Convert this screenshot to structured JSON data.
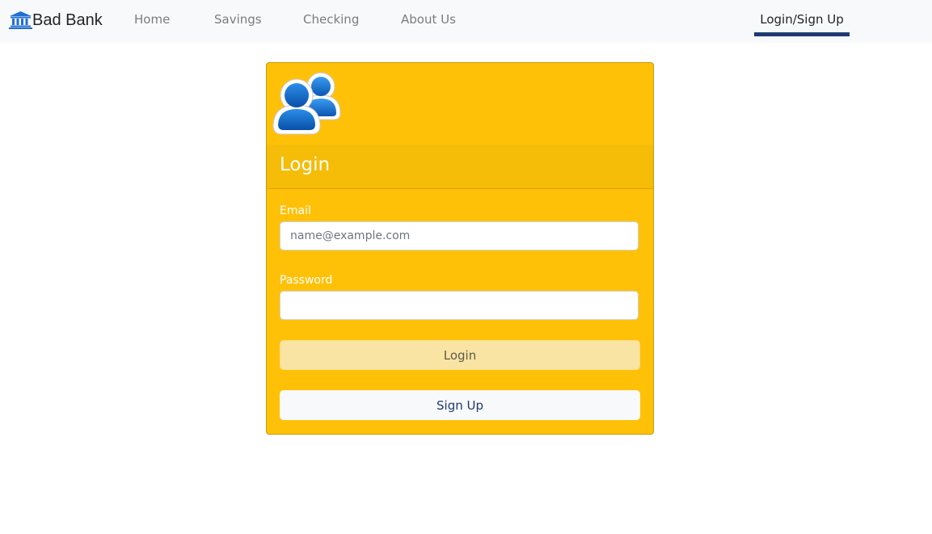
{
  "navbar": {
    "brand": {
      "icon": "bank-building-icon",
      "text": "Bad Bank",
      "icon_color": "#1f6fd1"
    },
    "links": [
      {
        "label": "Home"
      },
      {
        "label": "Savings"
      },
      {
        "label": "Checking"
      },
      {
        "label": "About Us"
      }
    ],
    "active_link": {
      "label": "Login/Sign Up"
    },
    "active_indicator_color": "#1f3a73"
  },
  "card": {
    "icon": "users-icon",
    "background_color": "#ffc107",
    "title": "Login",
    "email": {
      "label": "Email",
      "placeholder": "name@example.com",
      "value": ""
    },
    "password": {
      "label": "Password",
      "value": ""
    },
    "login_button": {
      "label": "Login"
    },
    "signup_button": {
      "label": "Sign Up"
    }
  }
}
